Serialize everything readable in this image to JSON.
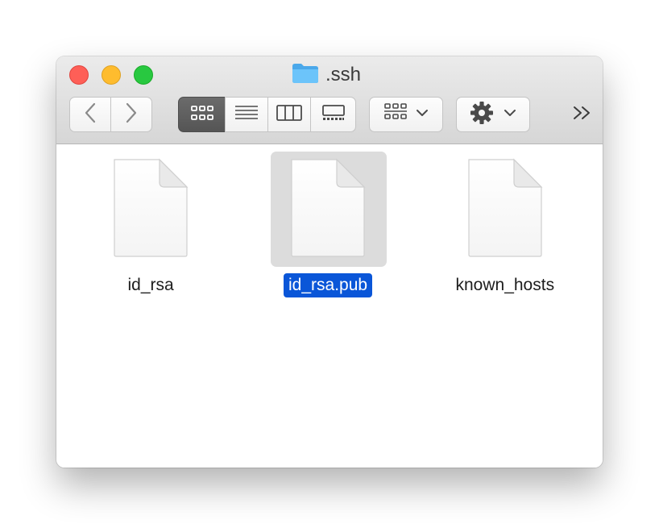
{
  "window": {
    "title": ".ssh",
    "title_icon": "folder-icon",
    "folder_color": "#5ab4f0"
  },
  "traffic_lights": {
    "close": "#fe5f57",
    "minimize": "#febc2e",
    "zoom": "#28c840"
  },
  "toolbar": {
    "back_icon": "chevron-left-icon",
    "forward_icon": "chevron-right-icon",
    "view_modes": [
      {
        "name": "icon-view",
        "icon": "grid-icon",
        "selected": true
      },
      {
        "name": "list-view",
        "icon": "list-icon",
        "selected": false
      },
      {
        "name": "column-view",
        "icon": "columns-icon",
        "selected": false
      },
      {
        "name": "gallery-view",
        "icon": "gallery-icon",
        "selected": false
      }
    ],
    "group_icon": "group-grid-icon",
    "action_icon": "gear-icon",
    "more_label": ">>"
  },
  "files": [
    {
      "name": "id_rsa",
      "icon": "document-icon",
      "selected": false
    },
    {
      "name": "id_rsa.pub",
      "icon": "document-icon",
      "selected": true
    },
    {
      "name": "known_hosts",
      "icon": "document-icon",
      "selected": false
    }
  ],
  "colors": {
    "selection_label": "#0a56d8",
    "selection_thumb": "#dcdcdc"
  }
}
